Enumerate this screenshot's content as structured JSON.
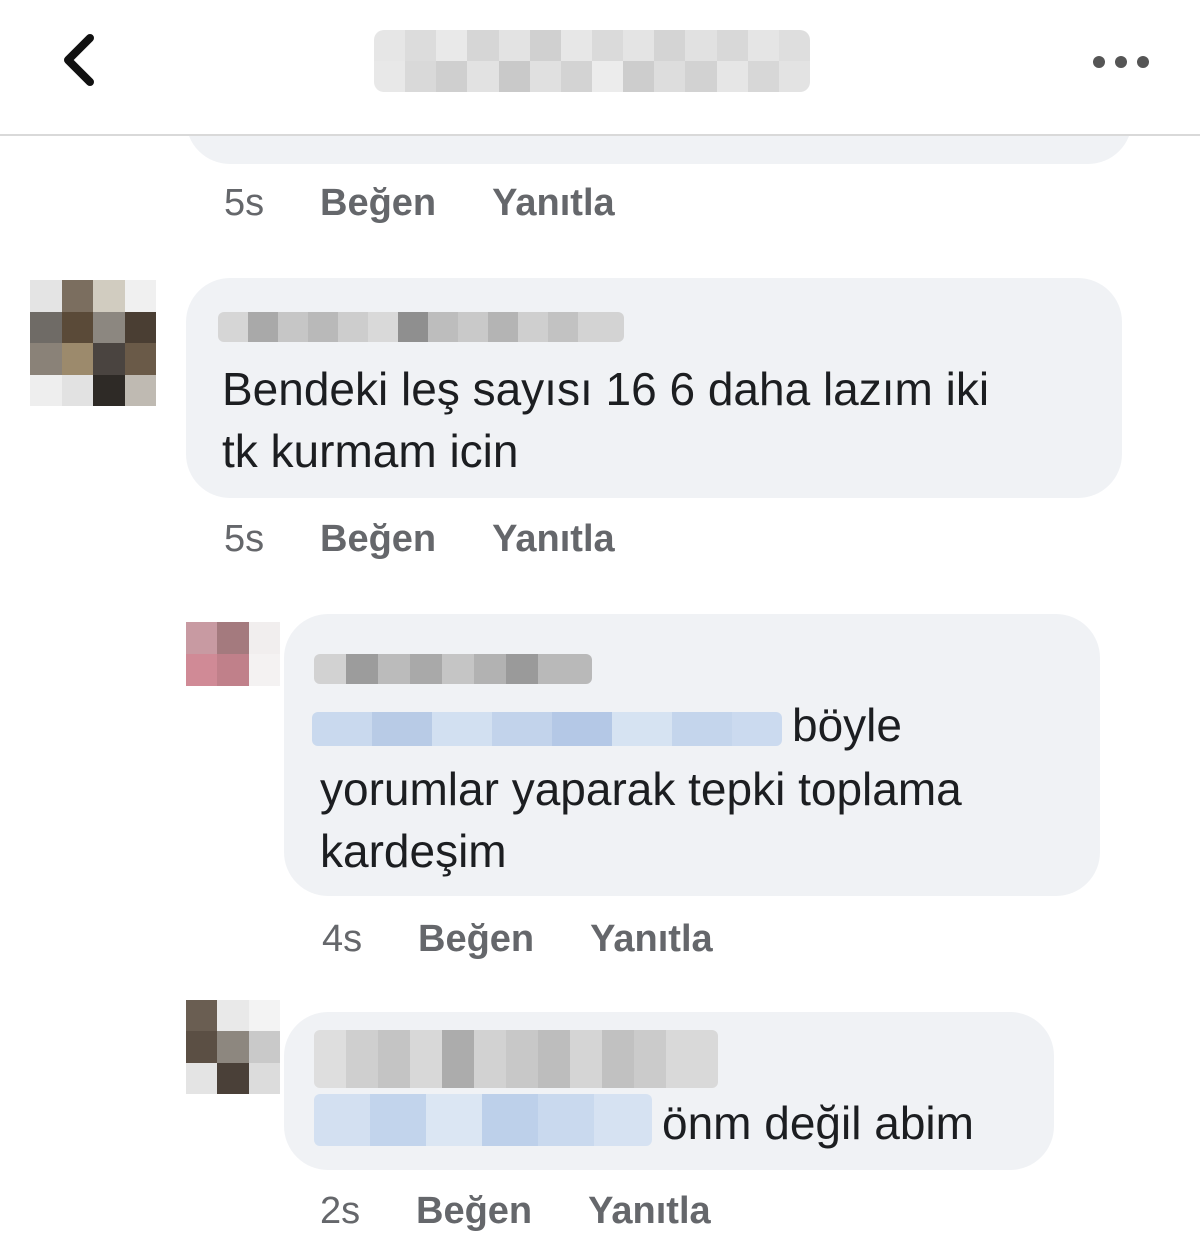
{
  "header": {
    "back_icon": "chevron-left-icon",
    "title": "",
    "more_icon": "more-horizontal-icon"
  },
  "comments": [
    {
      "time": "5s",
      "like_label": "Beğen",
      "reply_label": "Yanıtla"
    },
    {
      "text": "Bendeki  leş sayısı 16 6 daha lazım iki\ntk kurmam icin",
      "time": "5s",
      "like_label": "Beğen",
      "reply_label": "Yanıtla"
    },
    {
      "text_line1": "böyle",
      "text_rest": "yorumlar yaparak tepki  toplama\nkardeşim",
      "time": "4s",
      "like_label": "Beğen",
      "reply_label": "Yanıtla"
    },
    {
      "text": "önm değil abim",
      "time": "2s",
      "like_label": "Beğen",
      "reply_label": "Yanıtla"
    }
  ],
  "colors": {
    "bubble": "#f0f2f5",
    "meta_text": "#65676b",
    "body_text": "#1c1e21",
    "mention_blur": "#c8d8ee"
  }
}
